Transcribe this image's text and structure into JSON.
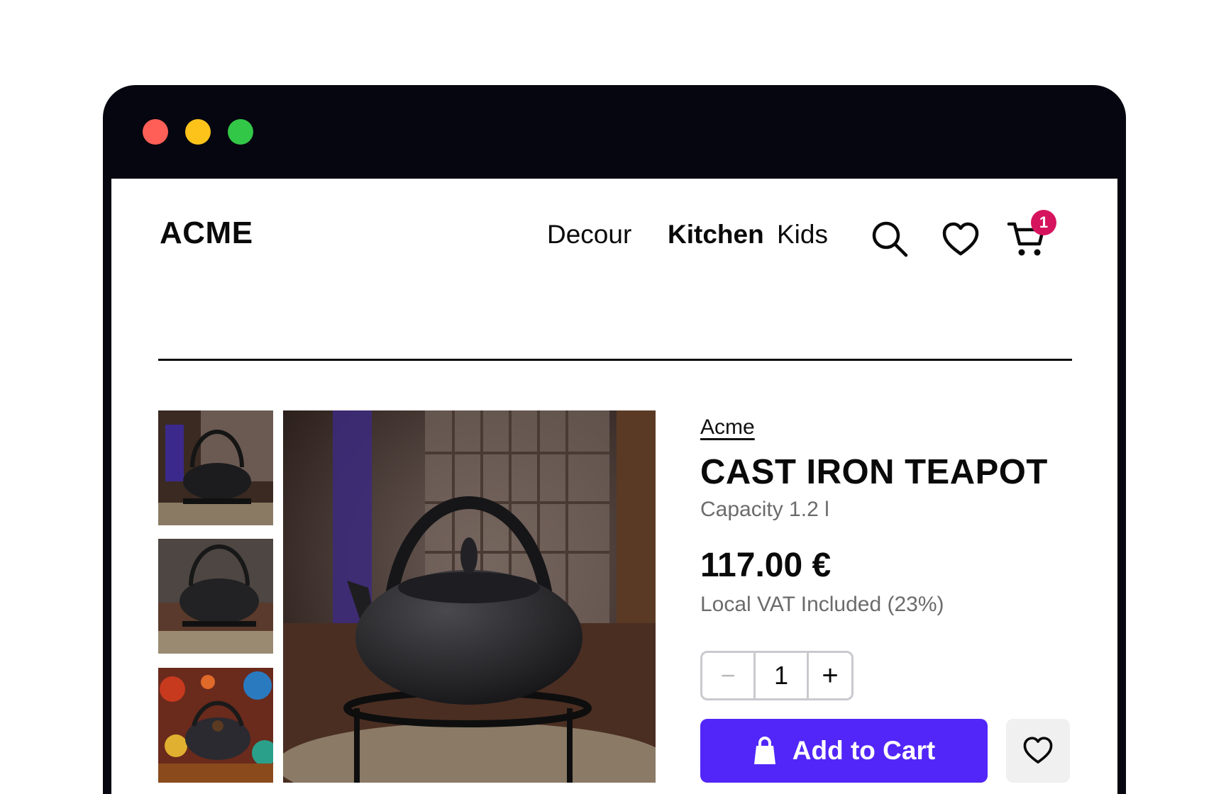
{
  "header": {
    "logo": "ACME",
    "nav": [
      {
        "label": "Decour",
        "active": false
      },
      {
        "label": "Kitchen",
        "active": true
      },
      {
        "label": "Kids",
        "active": false
      }
    ],
    "icons": [
      "search-icon",
      "heart-icon",
      "cart-icon"
    ],
    "cart_count": "1"
  },
  "product": {
    "brand": "Acme",
    "title": "CAST IRON TEAPOT",
    "capacity": "Capacity 1.2 l",
    "price": "117.00 €",
    "vat_note": "Local VAT Included (23%)",
    "quantity": "1",
    "qty_minus": "−",
    "qty_plus": "+",
    "add_to_cart_label": "Add to Cart"
  },
  "gallery": {
    "thumbnails": [
      "teapot-photo-1",
      "teapot-photo-2",
      "teapot-photo-3"
    ],
    "main_image": "teapot-photo-main"
  },
  "colors": {
    "accent": "#5226f8",
    "badge": "#d6145e",
    "window_chrome": "#05060f",
    "traffic_red": "#ff5f57",
    "traffic_yellow": "#fdc31b",
    "traffic_green": "#33c748"
  }
}
